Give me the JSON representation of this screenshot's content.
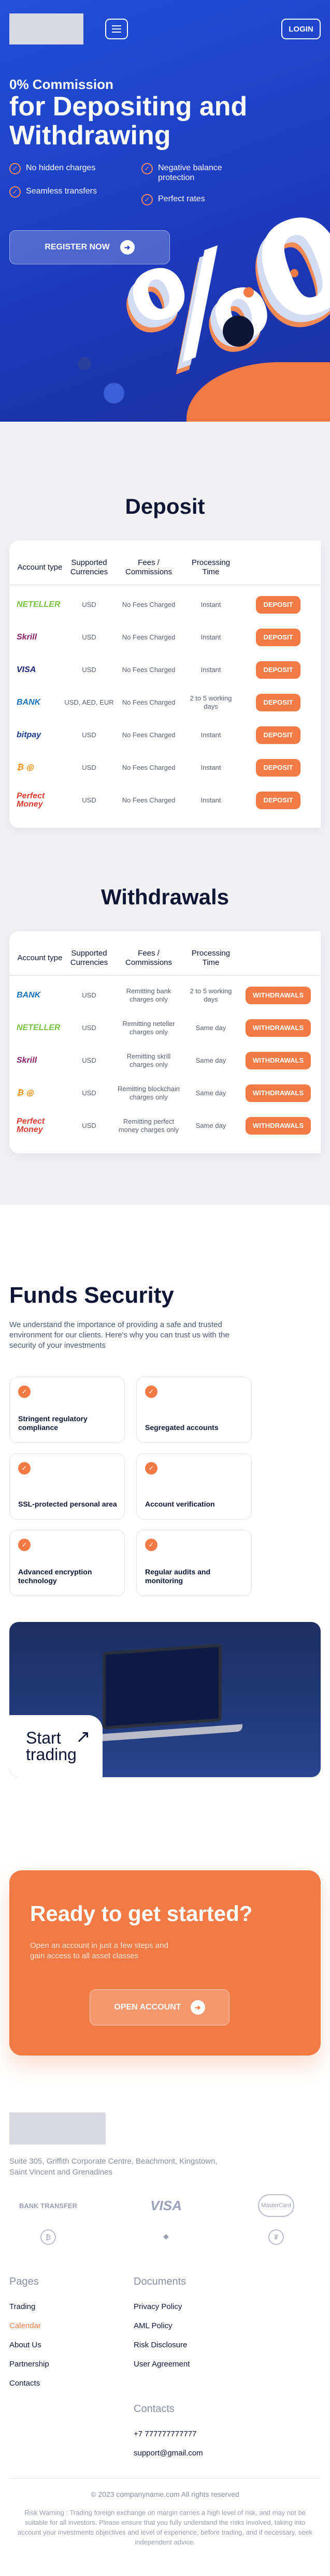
{
  "header": {
    "login_label": "LOGIN"
  },
  "hero": {
    "subtitle": "0% Commission",
    "title": "for Depositing and Withdrawing",
    "features": [
      "No hidden charges",
      "Negative balance protection",
      "Seamless transfers",
      "Perfect rates"
    ],
    "register_label": "REGISTER NOW",
    "percent_glyph": "%0"
  },
  "deposit": {
    "title": "Deposit",
    "headers": [
      "Account type",
      "Supported Currencies",
      "Fees / Commissions",
      "Processing Time"
    ],
    "rows": [
      {
        "brand": "NETELLER",
        "brand_color": "#7ac143",
        "currencies": "USD",
        "fees": "No Fees Charged",
        "time": "Instant",
        "action": "DEPOSIT"
      },
      {
        "brand": "Skrill",
        "brand_color": "#862165",
        "currencies": "USD",
        "fees": "No Fees Charged",
        "time": "Instant",
        "action": "DEPOSIT"
      },
      {
        "brand": "VISA",
        "brand_color": "#1a1f71",
        "currencies": "USD",
        "fees": "No Fees Charged",
        "time": "Instant",
        "action": "DEPOSIT"
      },
      {
        "brand": "BANK",
        "brand_color": "#1a73b8",
        "currencies": "USD, AED, EUR",
        "fees": "No Fees Charged",
        "time": "2 to 5 working days",
        "action": "DEPOSIT"
      },
      {
        "brand": "bitpay",
        "brand_color": "#1a3b8b",
        "currencies": "USD",
        "fees": "No Fees Charged",
        "time": "Instant",
        "action": "DEPOSIT"
      },
      {
        "brand": "₿ ◎",
        "brand_color": "#f7931a",
        "currencies": "USD",
        "fees": "No Fees Charged",
        "time": "Instant",
        "action": "DEPOSIT"
      },
      {
        "brand": "Perfect Money",
        "brand_color": "#e03c31",
        "currencies": "USD",
        "fees": "No Fees Charged",
        "time": "Instant",
        "action": "DEPOSIT"
      }
    ]
  },
  "withdrawals": {
    "title": "Withdrawals",
    "headers": [
      "Account type",
      "Supported Currencies",
      "Fees / Commissions",
      "Processing Time"
    ],
    "rows": [
      {
        "brand": "BANK",
        "brand_color": "#1a73b8",
        "currencies": "USD",
        "fees": "Remitting bank charges only",
        "time": "2 to 5 working days",
        "action": "WITHDRAWALS"
      },
      {
        "brand": "NETELLER",
        "brand_color": "#7ac143",
        "currencies": "USD",
        "fees": "Remitting neteller charges only",
        "time": "Same day",
        "action": "WITHDRAWALS"
      },
      {
        "brand": "Skrill",
        "brand_color": "#862165",
        "currencies": "USD",
        "fees": "Remitting skrill charges only",
        "time": "Same day",
        "action": "WITHDRAWALS"
      },
      {
        "brand": "₿ ◎",
        "brand_color": "#f7931a",
        "currencies": "USD",
        "fees": "Remitting blockchain charges only",
        "time": "Same day",
        "action": "WITHDRAWALS"
      },
      {
        "brand": "Perfect Money",
        "brand_color": "#e03c31",
        "currencies": "USD",
        "fees": "Remitting perfect money charges only",
        "time": "Same day",
        "action": "WITHDRAWALS"
      }
    ]
  },
  "security": {
    "title": "Funds Security",
    "lead": "We understand the importance of providing a safe and trusted environment for our clients. Here's why you can trust us with the security of your investments",
    "cards": [
      "Stringent regulatory compliance",
      "Segregated accounts",
      "SSL-protected personal area",
      "Account verification",
      "Advanced encryption technology",
      "Regular audits and monitoring"
    ],
    "trade_label": "Start trading"
  },
  "cta": {
    "title": "Ready to get started?",
    "text": "Open an account in just a few steps and gain access to all asset classes",
    "button": "OPEN ACCOUNT"
  },
  "footer": {
    "address": "Suite 305, Griffith Corporate Centre, Beachmont, Kingstown, Saint Vincent and Grenadines",
    "payments": {
      "bank": "BANK TRANSFER",
      "visa": "VISA",
      "mastercard": "MasterCard",
      "bitcoin": "₿",
      "ethereum": "◆",
      "tether": "₮"
    },
    "pages_title": "Pages",
    "pages": [
      "Trading",
      "Calendar",
      "About Us",
      "Partnership",
      "Contacts"
    ],
    "docs_title": "Documents",
    "docs": [
      "Privacy Policy",
      "AML Policy",
      "Risk Disclosure",
      "User Agreement"
    ],
    "contacts_title": "Contacts",
    "phone": "+7 777777777777",
    "email": "support@gmail.com",
    "copyright": "© 2023 companyname.com All rights reserved",
    "risk": "Risk Warning : Trading foreign exchange on margin carries a high level of risk, and may not be suitable for all investors. Please ensure that you fully understand the risks involved, taking into account your investments objectives and level of experience, before trading, and if necessary, seek independent advice."
  }
}
